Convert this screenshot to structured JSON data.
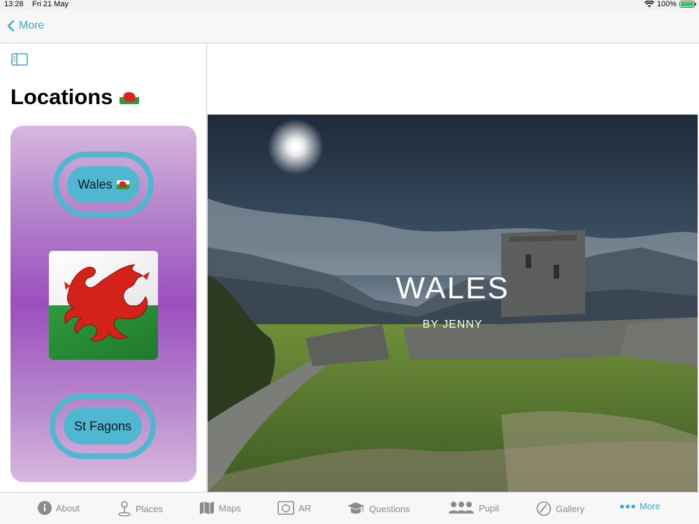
{
  "status_bar": {
    "time": "13:28",
    "date": "Fri 21 May",
    "battery": "100%",
    "battery_level": 1.0
  },
  "nav": {
    "back_label": "More"
  },
  "sidebar": {
    "title": "Locations",
    "buttons": [
      {
        "label": "Wales"
      },
      {
        "label": "St Fagons"
      }
    ]
  },
  "hero": {
    "title": "WALES",
    "subtitle": "BY JENNY"
  },
  "tabs": [
    {
      "label": "About",
      "icon": "info-icon"
    },
    {
      "label": "Places",
      "icon": "map-pin-icon"
    },
    {
      "label": "Maps",
      "icon": "map-icon"
    },
    {
      "label": "AR",
      "icon": "ar-icon"
    },
    {
      "label": "Questions",
      "icon": "graduation-cap-icon"
    },
    {
      "label": "Pupil",
      "icon": "people-icon"
    },
    {
      "label": "Gallery",
      "icon": "gallery-icon"
    },
    {
      "label": "More",
      "icon": "more-icon"
    }
  ],
  "colors": {
    "accent": "#3fa9d6",
    "button": "#4fb8d0",
    "panel": "#9b4fbe"
  }
}
